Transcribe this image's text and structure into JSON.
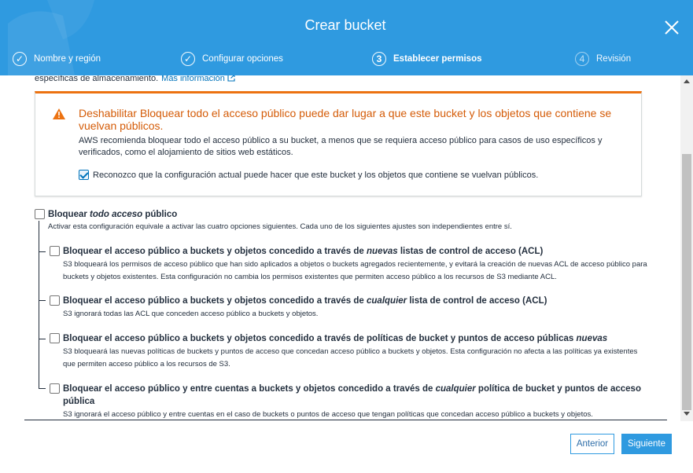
{
  "dialog": {
    "title": "Crear bucket",
    "steps": [
      {
        "number": "✓",
        "label": "Nombre y región"
      },
      {
        "number": "✓",
        "label": "Configurar opciones"
      },
      {
        "number": "3",
        "label": "Establecer permisos"
      },
      {
        "number": "4",
        "label": "Revisión"
      }
    ]
  },
  "content": {
    "top_text": "específicas de almacenamiento.",
    "more_info_link": "Más información",
    "warning": {
      "title": "Deshabilitar Bloquear todo el acceso público puede dar lugar a que este bucket y los objetos que contiene se vuelvan públicos.",
      "description": "AWS recomienda bloquear todo el acceso público a su bucket, a menos que se requiera acceso público para casos de uso específicos y verificados, como el alojamiento de sitios web estáticos.",
      "acknowledge_label": "Reconozco que la configuración actual puede hacer que este bucket y los objetos que contiene se vuelvan públicos.",
      "acknowledge_checked": true
    },
    "block_all": {
      "label_pre": "Bloquear ",
      "label_em": "todo acceso",
      "label_post": " público",
      "description": "Activar esta configuración equivale a activar las cuatro opciones siguientes. Cada uno de los siguientes ajustes son independientes entre sí.",
      "checked": false
    },
    "options": [
      {
        "label_pre": "Bloquear el acceso público a buckets y objetos concedido a través de ",
        "label_em": "nuevas",
        "label_post": " listas de control de acceso (ACL)",
        "description": "S3 bloqueará los permisos de acceso público que han sido aplicados a objetos o buckets agregados recientemente, y evitará la creación de nuevas ACL de acceso público para buckets y objetos existentes. Esta configuración no cambia los permisos existentes que permiten acceso público a los recursos de S3 mediante ACL."
      },
      {
        "label_pre": "Bloquear el acceso público a buckets y objetos concedido a través de ",
        "label_em": "cualquier",
        "label_post": " lista de control de acceso (ACL)",
        "description": "S3 ignorará todas las ACL que conceden acceso público a buckets y objetos."
      },
      {
        "label_pre": "Bloquear el acceso público a buckets y objetos concedido a través de políticas de bucket y puntos de acceso públicas ",
        "label_em": "nuevas",
        "label_post": "",
        "description": "S3 bloqueará las nuevas políticas de buckets y puntos de acceso que concedan acceso público a buckets y objetos. Esta configuración no afecta a las políticas ya existentes que permiten acceso público a los recursos de S3."
      },
      {
        "label_pre": "Bloquear el acceso público y entre cuentas a buckets y objetos concedido a través de ",
        "label_em": "cualquier",
        "label_post": " política de bucket y puntos de acceso pública",
        "description": "S3 ignorará el acceso público y entre cuentas en el caso de buckets o puntos de acceso que tengan políticas que concedan acceso público a buckets y objetos."
      }
    ]
  },
  "footer": {
    "prev_label": "Anterior",
    "next_label": "Siguiente"
  },
  "colors": {
    "header": "#2f9ae0",
    "warning_accent": "#ec7211",
    "warning_title": "#d45b07",
    "link": "#0073bb"
  }
}
